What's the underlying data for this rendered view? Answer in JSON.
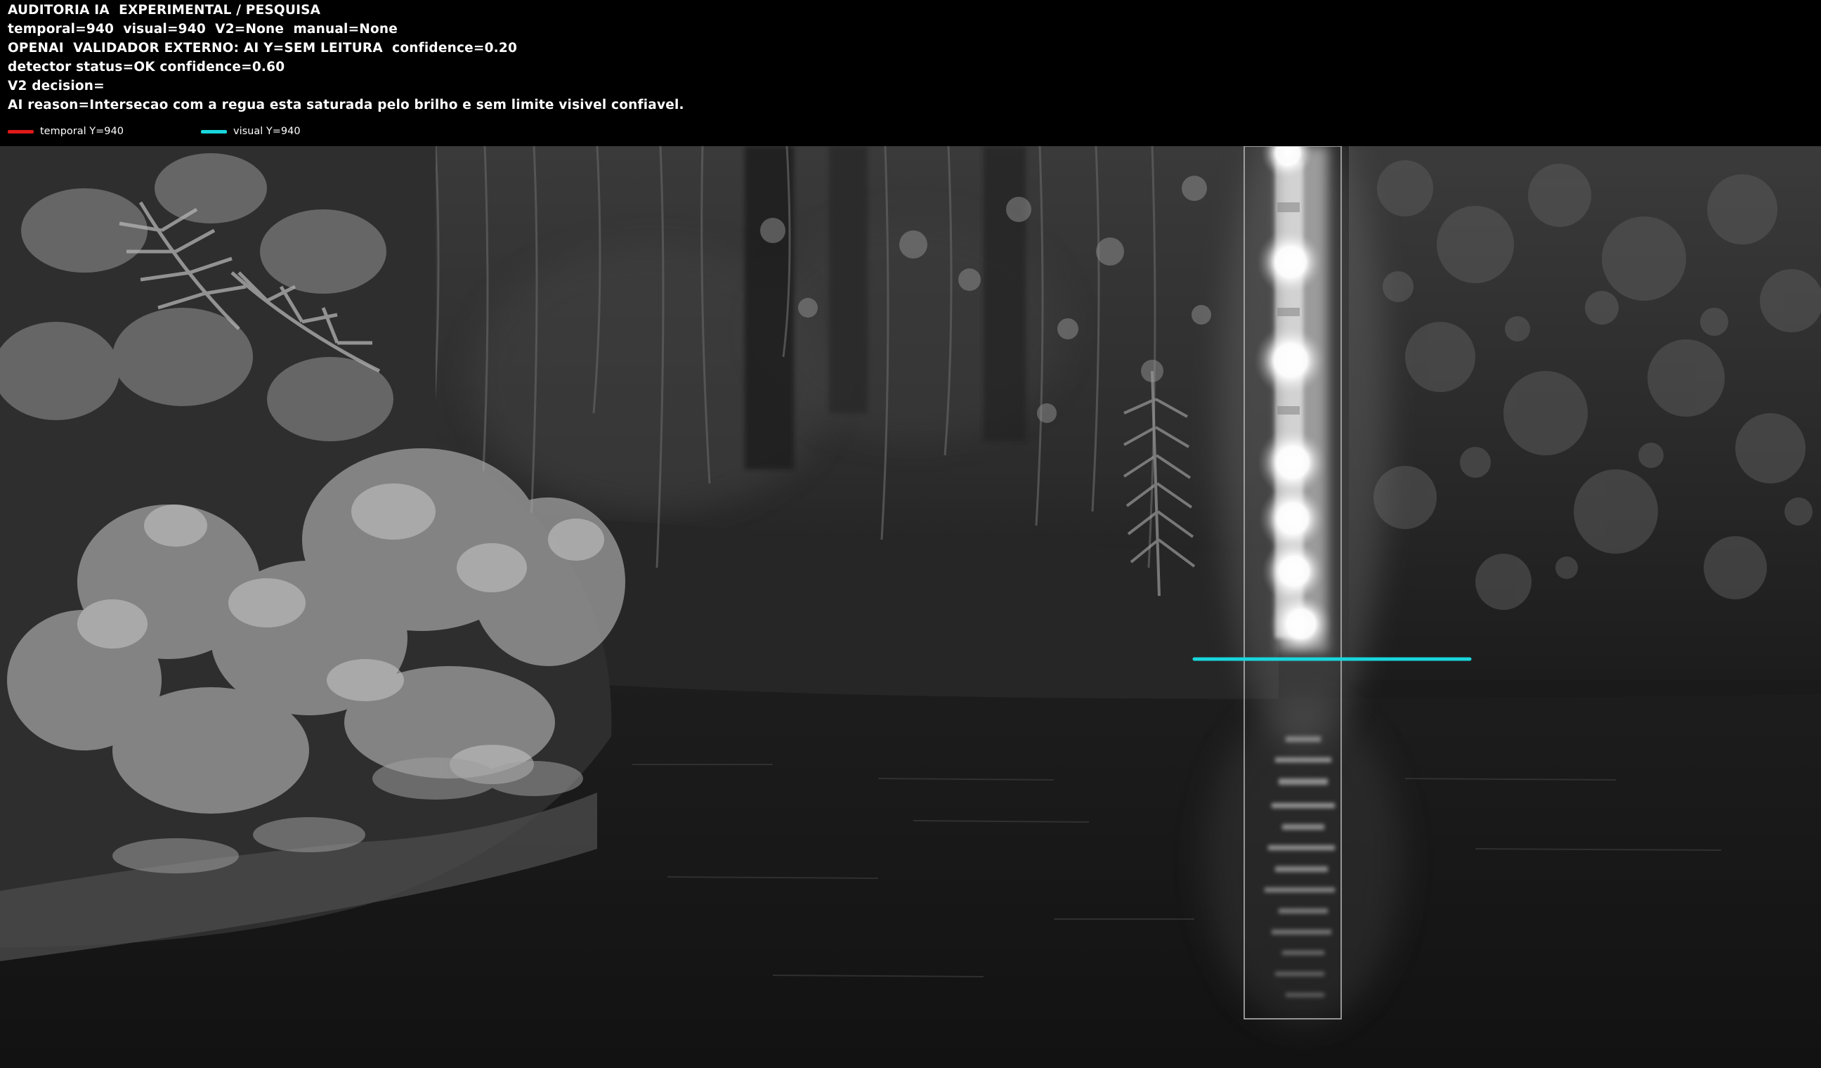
{
  "hud": {
    "lines": [
      "AUDITORIA IA  EXPERIMENTAL / PESQUISA",
      "temporal=940  visual=940  V2=None  manual=None",
      "OPENAI  VALIDADOR EXTERNO: AI Y=SEM LEITURA  confidence=0.20",
      "detector status=OK confidence=0.60",
      "V2 decision=",
      "AI reason=Intersecao com a regua esta saturada pelo brilho e sem limite visivel confiavel."
    ],
    "legend": [
      {
        "label": "temporal Y=940",
        "color": "#e01919"
      },
      {
        "label": "visual Y=940",
        "color": "#19d6dc"
      }
    ]
  },
  "overlay": {
    "visual_line_color": "#19d6dc",
    "roi_box_color": "#bdbdbd"
  }
}
